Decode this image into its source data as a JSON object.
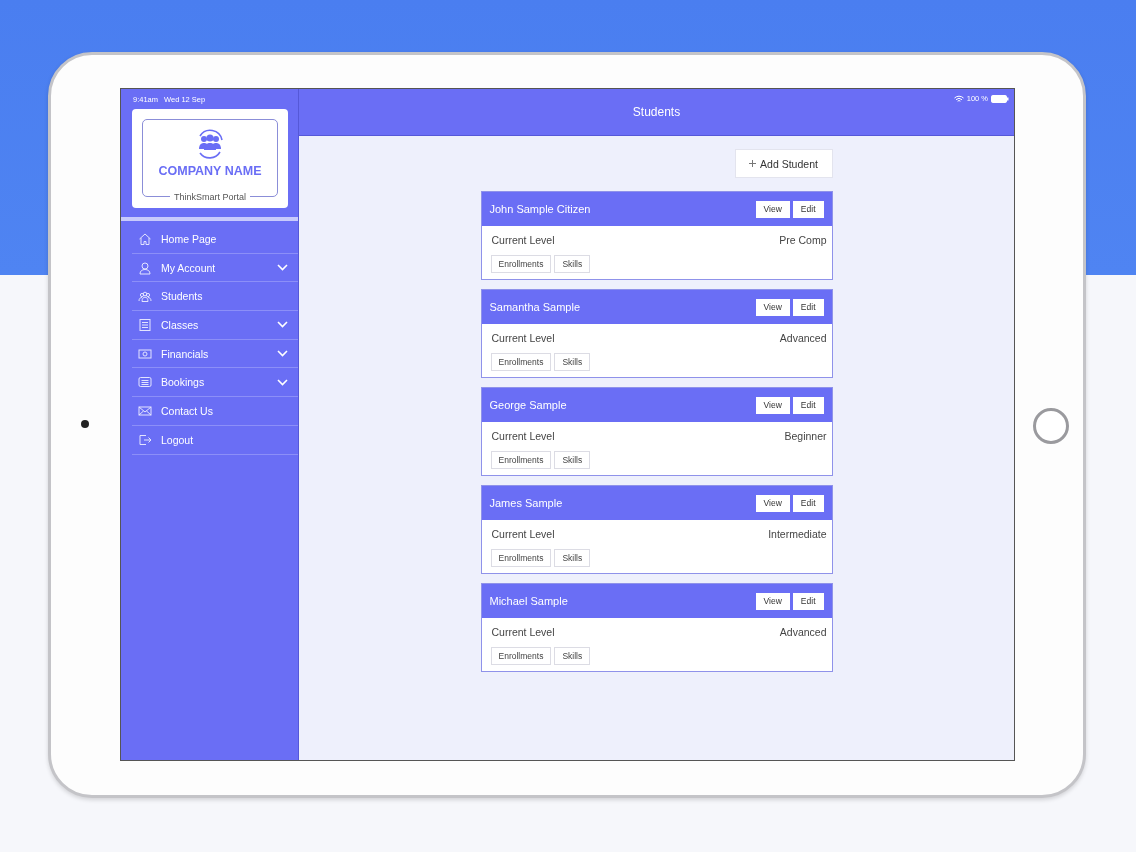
{
  "status_bar": {
    "time": "9:41am",
    "date": "Wed 12 Sep",
    "battery": "100 %"
  },
  "sidebar": {
    "company_name": "COMPANY NAME",
    "portal_name": "ThinkSmart Portal",
    "items": [
      {
        "label": "Home Page",
        "expandable": false
      },
      {
        "label": "My Account",
        "expandable": true
      },
      {
        "label": "Students",
        "expandable": false
      },
      {
        "label": "Classes",
        "expandable": true
      },
      {
        "label": "Financials",
        "expandable": true
      },
      {
        "label": "Bookings",
        "expandable": true
      },
      {
        "label": "Contact Us",
        "expandable": false
      },
      {
        "label": "Logout",
        "expandable": false
      }
    ]
  },
  "header": {
    "title": "Students"
  },
  "add_button": {
    "label": "Add Student"
  },
  "students": [
    {
      "name": "John Sample Citizen",
      "actions": [
        "View",
        "Edit"
      ],
      "level_label": "Current Level",
      "level": "Pre Comp",
      "links": [
        "Enrollments",
        "Skills"
      ]
    },
    {
      "name": "Samantha Sample",
      "actions": [
        "View",
        "Edit"
      ],
      "level_label": "Current Level",
      "level": "Advanced",
      "links": [
        "Enrollments",
        "Skills"
      ]
    },
    {
      "name": "George Sample",
      "actions": [
        "View",
        "Edit"
      ],
      "level_label": "Current Level",
      "level": "Beginner",
      "links": [
        "Enrollments",
        "Skills"
      ]
    },
    {
      "name": "James Sample",
      "actions": [
        "View",
        "Edit"
      ],
      "level_label": "Current Level",
      "level": "Intermediate",
      "links": [
        "Enrollments",
        "Skills"
      ]
    },
    {
      "name": "Michael Sample",
      "actions": [
        "View",
        "Edit"
      ],
      "level_label": "Current Level",
      "level": "Advanced",
      "links": [
        "Enrollments",
        "Skills"
      ]
    }
  ]
}
